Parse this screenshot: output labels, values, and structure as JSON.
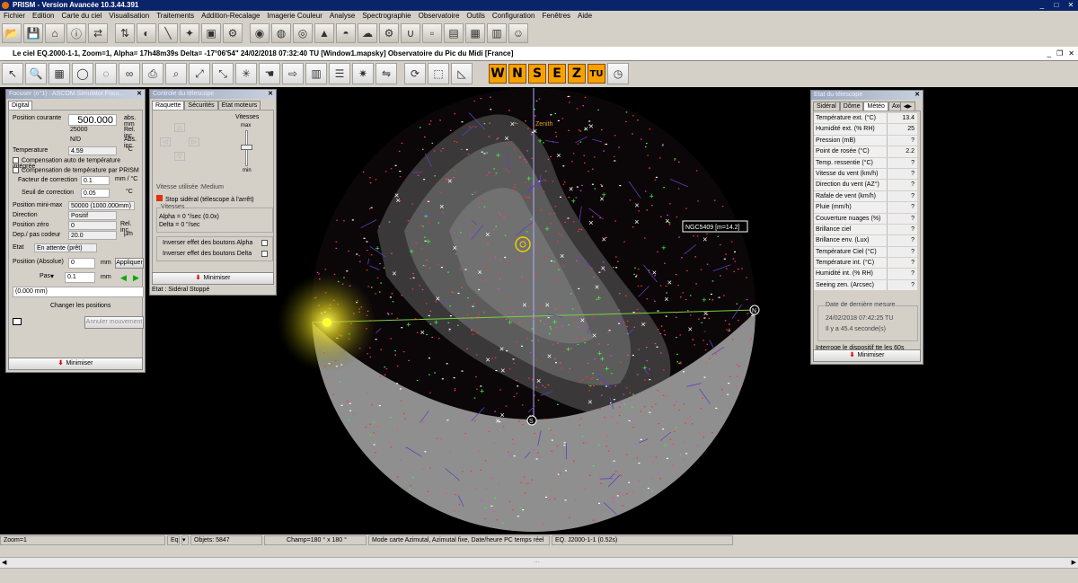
{
  "app": {
    "title": "PRISM - Version Avancée  10.3.44.391"
  },
  "menu": [
    "Fichier",
    "Edition",
    "Carte du ciel",
    "Visualisation",
    "Traitements",
    "Addition-Recalage",
    "Imagerie Couleur",
    "Analyse",
    "Spectrographie",
    "Observatoire",
    "Outils",
    "Configuration",
    "Fenêtres",
    "Aide"
  ],
  "child_window": {
    "title": "Le ciel EQ.2000-1-1, Zoom=1, Alpha= 17h48m39s Delta= -17°06'54\"   24/02/2018 07:32:40 TU [Window1.mapsky]  Observatoire du Pic du Midi [France]"
  },
  "direction_buttons": [
    "W",
    "N",
    "S",
    "E",
    "Z",
    "TU"
  ],
  "focuser": {
    "title": "Focuser (n°1) : ASCOM.Simulator.Focu...",
    "tab": "Digital",
    "pos_label": "Position courante",
    "pos_value": "500.000",
    "pos_unit": "abs. mm",
    "ref_value": "25000",
    "ref_unit": "Rel. inc.",
    "nd_value": "N/D",
    "nd_unit": "Abs. inc.",
    "temp_label": "Temperature",
    "temp_value": "4.59",
    "temp_unit": "°C",
    "comp1": "Compensation auto de température intégrée",
    "comp2": "Compensation de température par PRISM",
    "factor_label": "Facteur de correction",
    "factor_value": "0.1",
    "factor_unit": "mm / °C",
    "seuil_label": "Seuil de correction",
    "seuil_value": "0.05",
    "seuil_unit": "°C",
    "minmax_label": "Position mini-max",
    "minmax_value": "50000 (1000.000mm)",
    "dir_label": "Direction",
    "dir_value": "Positif",
    "zero_label": "Position zéro",
    "zero_value": "0",
    "zero_unit": "Rel. inc.",
    "dep_label": "Dep./ pas codeur",
    "dep_value": "20.0",
    "dep_unit": "µm",
    "etat_label": "Etat",
    "etat_value": "En attente (prêt)",
    "posabs_label": "Position (Absolue)",
    "posabs_value": "0",
    "posabs_unit": "mm",
    "apply": "Appliquer",
    "pas_label": "Pas",
    "pas_value": "0.1",
    "pas_unit": "mm",
    "combo_value": "(0.000 mm)",
    "change_btn": "Changer les positions",
    "cancel_btn": "Annuler mouvement",
    "minimize": "Minimiser"
  },
  "telescope": {
    "title": "Controle du télescope",
    "tabs": [
      "Raquette",
      "Sécurités",
      "Etat moteurs"
    ],
    "vitesses": "Vitesses",
    "max": "max",
    "min": "min",
    "vitesse_label": "Vitesse utilisée :",
    "vitesse_value": "Medium",
    "stop": "Stop sidéral (télescope à l'arrêt)",
    "vit_title": "Vitesses",
    "alpha": "Alpha = 0 \"/sec (0.0x)",
    "delta": "Delta = 0 \"/sec",
    "inv_alpha": "Inverser effet des boutons Alpha",
    "inv_delta": "Inverser effet des boutons Delta",
    "minimize": "Minimiser",
    "status": "Etat : Sidéral Stoppé"
  },
  "meteo": {
    "title": "Etat du télescope",
    "tabs": [
      "Sidéral",
      "Dôme",
      "Météo",
      "Axes"
    ],
    "rows": [
      {
        "k": "Température ext. (°C)",
        "v": "13.4"
      },
      {
        "k": "Humidité ext. (% RH)",
        "v": "25"
      },
      {
        "k": "Pression (mB)",
        "v": "?"
      },
      {
        "k": "Point de rosée (°C)",
        "v": "2.2"
      },
      {
        "k": "Temp. ressentie (°C)",
        "v": "?"
      },
      {
        "k": "Vitesse du vent (km/h)",
        "v": "?"
      },
      {
        "k": "Direction du vent (AZ°)",
        "v": "?"
      },
      {
        "k": "Rafale de vent (km/h)",
        "v": "?"
      },
      {
        "k": "Pluie (mm/h)",
        "v": "?"
      },
      {
        "k": "Couverture nuages (%)",
        "v": "?"
      },
      {
        "k": "Brillance ciel (Mg/arcsec²)",
        "v": "?"
      },
      {
        "k": "Brillance env. (Lux)",
        "v": "?"
      },
      {
        "k": "Température Ciel (°C)",
        "v": "?"
      },
      {
        "k": "Température int. (°C)",
        "v": "?"
      },
      {
        "k": "Humidité int. (% RH)",
        "v": "?"
      },
      {
        "k": "Seeing zen. (Arcsec)",
        "v": "?"
      }
    ],
    "last_title": "Date de dernière mesure",
    "last_date": "24/02/2018 07:42:25 TU",
    "ago": "Il y a 45.4  seconde(s)",
    "poll": "Interroge le dispositif tte les 60s",
    "minimize": "Minimiser"
  },
  "sky": {
    "zenith": "Zenith",
    "ngc_label": "NGC5409 [m=14.2]",
    "north": "N",
    "south": "S"
  },
  "status": {
    "zoom": "Zoom=1",
    "eq": "Eq",
    "objets": "Objets: 5847",
    "champ": "Champ=180 ° x 180 °",
    "mode": "Mode carte Azimutal, Azimutal fixe, Date/heure PC temps réel",
    "ref": "EQ. J2000-1-1 (0.52s)"
  }
}
